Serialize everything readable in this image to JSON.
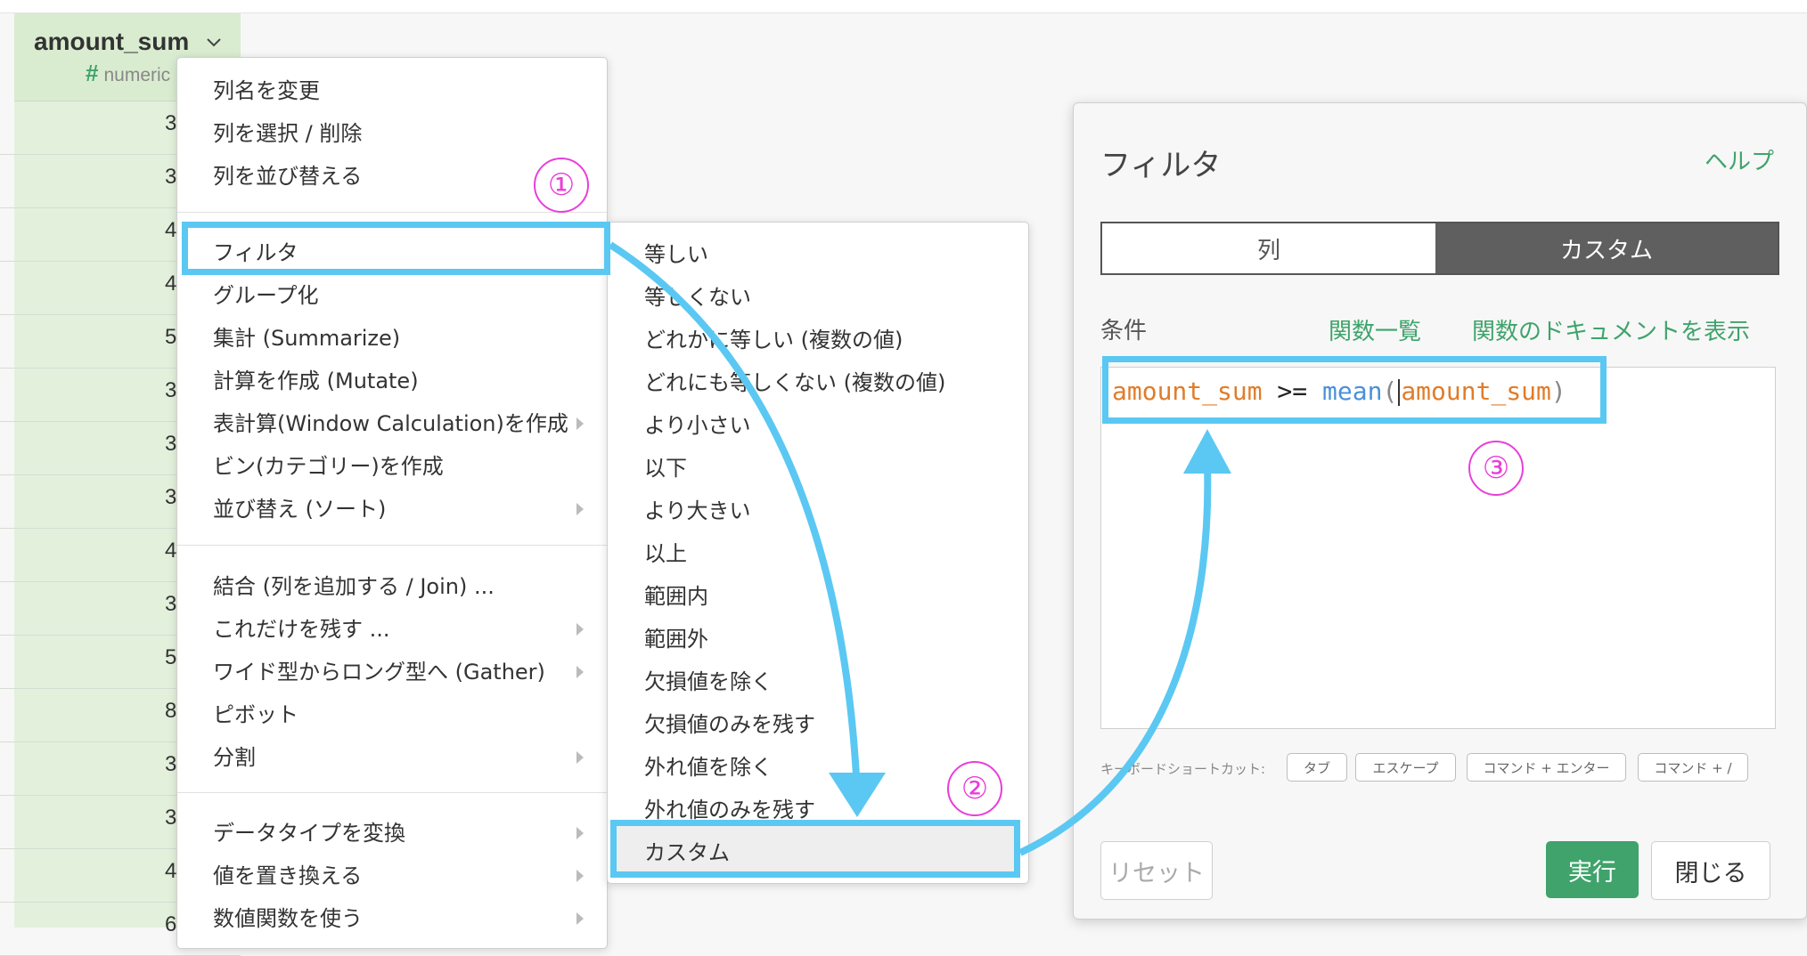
{
  "column": {
    "name": "amount_sum",
    "type_label": "numeric",
    "type_icon": "#",
    "visible_values": [
      "3",
      "3",
      "4",
      "4",
      "5",
      "3",
      "3",
      "3",
      "4",
      "3",
      "5",
      "8",
      "3",
      "3",
      "4",
      "6"
    ]
  },
  "menu": {
    "group1": [
      "列名を変更",
      "列を選択 / 削除",
      "列を並び替える"
    ],
    "group2": [
      "フィルタ",
      "グループ化",
      "集計 (Summarize)",
      "計算を作成 (Mutate)",
      "表計算(Window Calculation)を作成",
      "ビン(カテゴリー)を作成",
      "並び替え (ソート)"
    ],
    "group3": [
      "結合 (列を追加する / Join) ...",
      "これだけを残す ...",
      "ワイド型からロング型へ (Gather)",
      "ピボット",
      "分割"
    ],
    "group4": [
      "データタイプを変換",
      "値を置き換える",
      "数値関数を使う"
    ]
  },
  "submenu": {
    "items": [
      "等しい",
      "等しくない",
      "どれかに等しい (複数の値)",
      "どれにも等しくない (複数の値)",
      "より小さい",
      "以下",
      "より大きい",
      "以上",
      "範囲内",
      "範囲外",
      "欠損値を除く",
      "欠損値のみを残す",
      "外れ値を除く",
      "外れ値のみを残す",
      "カスタム"
    ]
  },
  "dialog": {
    "title": "フィルタ",
    "help": "ヘルプ",
    "tab_column": "列",
    "tab_custom": "カスタム",
    "condition_label": "条件",
    "function_list": "関数一覧",
    "function_docs": "関数のドキュメントを表示",
    "code": {
      "field1": "amount_sum",
      "op": " >= ",
      "func": "mean",
      "open": "(",
      "field2": "amount_sum",
      "close": ")"
    },
    "shortcut_label": "キーボードショートカット:",
    "shortcuts": [
      "タブ",
      "エスケープ",
      "コマンド + エンター",
      "コマンド + /"
    ],
    "reset": "リセット",
    "run": "実行",
    "close": "閉じる"
  },
  "annotations": {
    "step1": "①",
    "step2": "②",
    "step3": "③"
  },
  "colors": {
    "accent_green": "#3fa36b",
    "highlight_blue": "#5ac8f2",
    "annotation_magenta": "#e83fd8",
    "column_green": "#e3f1dc"
  }
}
